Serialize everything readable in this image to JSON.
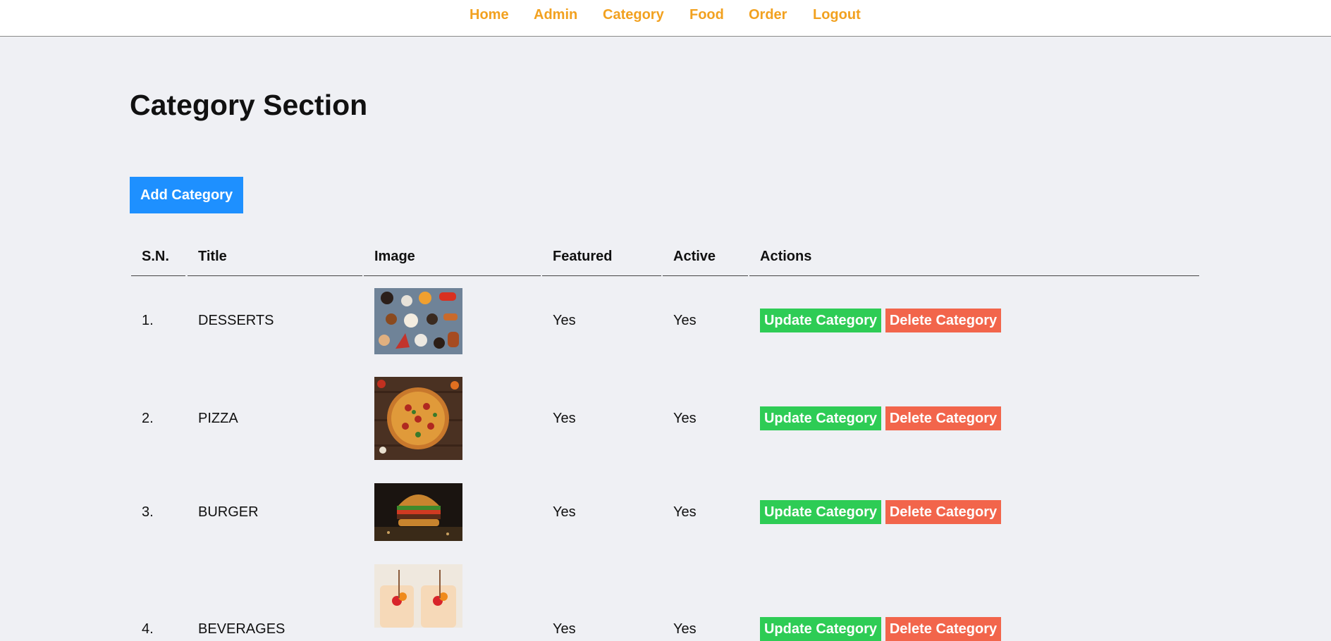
{
  "nav": {
    "items": [
      {
        "label": "Home"
      },
      {
        "label": "Admin"
      },
      {
        "label": "Category"
      },
      {
        "label": "Food"
      },
      {
        "label": "Order"
      },
      {
        "label": "Logout"
      }
    ]
  },
  "page": {
    "title": "Category Section",
    "add_button": "Add Category"
  },
  "table": {
    "headers": [
      "S.N.",
      "Title",
      "Image",
      "Featured",
      "Active",
      "Actions"
    ],
    "rows": [
      {
        "sn": "1.",
        "title": "DESSERTS",
        "image": "desserts-image",
        "featured": "Yes",
        "active": "Yes",
        "update": "Update Category",
        "delete": "Delete Category"
      },
      {
        "sn": "2.",
        "title": "PIZZA",
        "image": "pizza-image",
        "featured": "Yes",
        "active": "Yes",
        "update": "Update Category",
        "delete": "Delete Category"
      },
      {
        "sn": "3.",
        "title": "BURGER",
        "image": "burger-image",
        "featured": "Yes",
        "active": "Yes",
        "update": "Update Category",
        "delete": "Delete Category"
      },
      {
        "sn": "4.",
        "title": "BEVERAGES",
        "image": "beverages-image",
        "featured": "Yes",
        "active": "Yes",
        "update": "Update Category",
        "delete": "Delete Category"
      }
    ]
  },
  "colors": {
    "nav_link": "#f2a11f",
    "add_button": "#1e90ff",
    "update_button": "#2ecc55",
    "delete_button": "#f2654b",
    "page_background": "#eff0f4"
  }
}
